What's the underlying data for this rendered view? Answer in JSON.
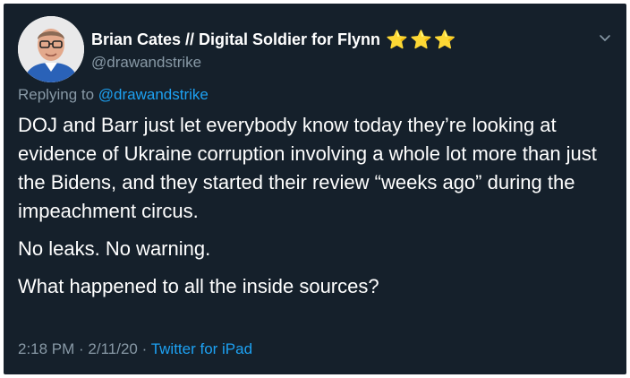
{
  "author": {
    "display_name": "Brian Cates // Digital Soldier for Flynn",
    "stars": "⭐⭐⭐",
    "handle": "@drawandstrike"
  },
  "reply": {
    "prefix": "Replying to ",
    "mention": "@drawandstrike"
  },
  "tweet": {
    "paragraphs": [
      "DOJ and Barr just let everybody know today they’re looking at evidence of Ukraine corruption involving a whole lot more than just the Bidens, and they started their review “weeks ago” during the impeachment circus.",
      "No leaks. No warning.",
      "What happened to all the inside sources?"
    ]
  },
  "meta": {
    "timestamp": "2:18 PM · 2/11/20 · ",
    "source": "Twitter for iPad"
  },
  "icons": {
    "avatar": "avatar-photo",
    "menu": "chevron-down-icon"
  },
  "colors": {
    "background": "#15202b",
    "text": "#ffffff",
    "secondary": "#8899a6",
    "link": "#1da1f2",
    "star": "#f5c518"
  }
}
